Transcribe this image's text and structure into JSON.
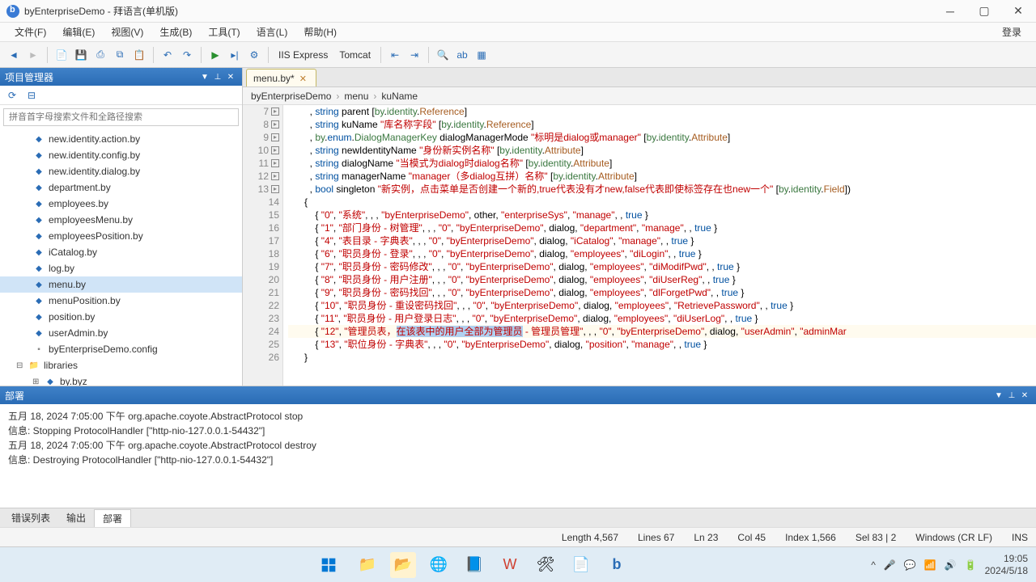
{
  "window": {
    "title": "byEnterpriseDemo - 拜语言(单机版)"
  },
  "menubar": {
    "items": [
      "文件(F)",
      "编辑(E)",
      "视图(V)",
      "生成(B)",
      "工具(T)",
      "语言(L)",
      "帮助(H)"
    ],
    "login": "登录"
  },
  "toolbar": {
    "servers": [
      "IIS Express",
      "Tomcat"
    ]
  },
  "sidebar": {
    "title": "项目管理器",
    "search_placeholder": "拼音首字母搜索文件和全路径搜索",
    "files": [
      "new.identity.action.by",
      "new.identity.config.by",
      "new.identity.dialog.by",
      "department.by",
      "employees.by",
      "employeesMenu.by",
      "employeesPosition.by",
      "iCatalog.by",
      "log.by",
      "menu.by",
      "menuPosition.by",
      "position.by",
      "userAdmin.by"
    ],
    "config": "byEnterpriseDemo.config",
    "libraries": "libraries",
    "libitem": "by.byz"
  },
  "editor": {
    "tab": "menu.by*",
    "breadcrumb": [
      "byEnterpriseDemo",
      "menu",
      "kuName"
    ],
    "lines": [
      {
        "n": 7,
        "html": "        , <span class='c-kw'>string</span> parent [<span class='c-id'>by</span>.<span class='c-id'>identity</span>.<span class='c-attr'>Reference</span>]"
      },
      {
        "n": 8,
        "html": "        , <span class='c-kw'>string</span> kuName <span class='c-str'>\"库名称字段\"</span> [<span class='c-id'>by</span>.<span class='c-id'>identity</span>.<span class='c-attr'>Reference</span>]"
      },
      {
        "n": 9,
        "html": "        , <span class='c-id'>by</span>.<span class='c-kw'>enum</span>.<span class='c-id'>DialogManagerKey</span> dialogManagerMode <span class='c-str'>\"标明是dialog或manager\"</span> [<span class='c-id'>by</span>.<span class='c-id'>identity</span>.<span class='c-attr'>Attribute</span>]"
      },
      {
        "n": 10,
        "html": "        , <span class='c-kw'>string</span> newIdentityName <span class='c-str'>\"身份新实例名称\"</span> [<span class='c-id'>by</span>.<span class='c-id'>identity</span>.<span class='c-attr'>Attribute</span>]"
      },
      {
        "n": 11,
        "html": "        , <span class='c-kw'>string</span> dialogName <span class='c-str'>\"当模式为dialog时dialog名称\"</span> [<span class='c-id'>by</span>.<span class='c-id'>identity</span>.<span class='c-attr'>Attribute</span>]"
      },
      {
        "n": 12,
        "html": "        , <span class='c-kw'>string</span> managerName <span class='c-str'>\"manager（多dialog互拼）名称\"</span> [<span class='c-id'>by</span>.<span class='c-id'>identity</span>.<span class='c-attr'>Attribute</span>]"
      },
      {
        "n": 13,
        "html": "        , <span class='c-kw'>bool</span> singleton <span class='c-str'>\"新实例，点击菜单是否创建一个新的,true代表没有才new,false代表即使标签存在也new一个\"</span> [<span class='c-id'>by</span>.<span class='c-id'>identity</span>.<span class='c-attr'>Field</span>])"
      },
      {
        "n": 14,
        "html": "      {"
      },
      {
        "n": 15,
        "html": "          { <span class='c-str'>\"0\"</span>, <span class='c-str'>\"系统\"</span>, , , <span class='c-str'>\"byEnterpriseDemo\"</span>, other, <span class='c-str'>\"enterpriseSys\"</span>, <span class='c-str'>\"manage\"</span>, , <span class='c-bool'>true</span> }"
      },
      {
        "n": 16,
        "html": "          { <span class='c-str'>\"1\"</span>, <span class='c-str'>\"部门身份 - 树管理\"</span>, , , <span class='c-str'>\"0\"</span>, <span class='c-str'>\"byEnterpriseDemo\"</span>, dialog, <span class='c-str'>\"department\"</span>, <span class='c-str'>\"manage\"</span>, , <span class='c-bool'>true</span> }"
      },
      {
        "n": 17,
        "html": "          { <span class='c-str'>\"4\"</span>, <span class='c-str'>\"表目录 - 字典表\"</span>, , , <span class='c-str'>\"0\"</span>, <span class='c-str'>\"byEnterpriseDemo\"</span>, dialog, <span class='c-str'>\"iCatalog\"</span>, <span class='c-str'>\"manage\"</span>, , <span class='c-bool'>true</span> }"
      },
      {
        "n": 18,
        "html": "          { <span class='c-str'>\"6\"</span>, <span class='c-str'>\"职员身份 - 登录\"</span>, , , <span class='c-str'>\"0\"</span>, <span class='c-str'>\"byEnterpriseDemo\"</span>, dialog, <span class='c-str'>\"employees\"</span>, <span class='c-str'>\"diLogin\"</span>, , <span class='c-bool'>true</span> }"
      },
      {
        "n": 19,
        "html": "          { <span class='c-str'>\"7\"</span>, <span class='c-str'>\"职员身份 - 密码修改\"</span>, , , <span class='c-str'>\"0\"</span>, <span class='c-str'>\"byEnterpriseDemo\"</span>, dialog, <span class='c-str'>\"employees\"</span>, <span class='c-str'>\"diModifPwd\"</span>, , <span class='c-bool'>true</span> }"
      },
      {
        "n": 20,
        "html": "          { <span class='c-str'>\"8\"</span>, <span class='c-str'>\"职员身份 - 用户注册\"</span>, , , <span class='c-str'>\"0\"</span>, <span class='c-str'>\"byEnterpriseDemo\"</span>, dialog, <span class='c-str'>\"employees\"</span>, <span class='c-str'>\"diUserReg\"</span>, , <span class='c-bool'>true</span> }"
      },
      {
        "n": 21,
        "html": "          { <span class='c-str'>\"9\"</span>, <span class='c-str'>\"职员身份 - 密码找回\"</span>, , , <span class='c-str'>\"0\"</span>, <span class='c-str'>\"byEnterpriseDemo\"</span>, dialog, <span class='c-str'>\"employees\"</span>, <span class='c-str'>\"dlForgetPwd\"</span>, , <span class='c-bool'>true</span> }"
      },
      {
        "n": 22,
        "html": "          { <span class='c-str'>\"10\"</span>, <span class='c-str'>\"职员身份 - 重设密码找回\"</span>, , , <span class='c-str'>\"0\"</span>, <span class='c-str'>\"byEnterpriseDemo\"</span>, dialog, <span class='c-str'>\"employees\"</span>, <span class='c-str'>\"RetrievePassword\"</span>, , <span class='c-bool'>true</span> }"
      },
      {
        "n": 23,
        "html": "          { <span class='c-str'>\"11\"</span>, <span class='c-str'>\"职员身份 - 用户登录日志\"</span>, , , <span class='c-str'>\"0\"</span>, <span class='c-str'>\"byEnterpriseDemo\"</span>, dialog, <span class='c-str'>\"employees\"</span>, <span class='c-str'>\"diUserLog\"</span>, , <span class='c-bool'>true</span> }"
      },
      {
        "n": 24,
        "hl": true,
        "html": "          { <span class='c-str'>\"12\"</span>, <span class='c-str'>\"管理员表，<span class='c-sel'>在该表中的用户全部为管理员</span> - 管理员管理\"</span>, , , <span class='c-str'>\"0\"</span>, <span class='c-str'>\"byEnterpriseDemo\"</span>, dialog, <span class='c-str'>\"userAdmin\"</span>, <span class='c-str'>\"adminMar</span>"
      },
      {
        "n": 25,
        "html": "          { <span class='c-str'>\"13\"</span>, <span class='c-str'>\"职位身份 - 字典表\"</span>, , , <span class='c-str'>\"0\"</span>, <span class='c-str'>\"byEnterpriseDemo\"</span>, dialog, <span class='c-str'>\"position\"</span>, <span class='c-str'>\"manage\"</span>, , <span class='c-bool'>true</span> }"
      },
      {
        "n": 26,
        "html": "      }"
      }
    ]
  },
  "output": {
    "title": "部署",
    "lines": [
      "五月 18, 2024 7:05:00 下午 org.apache.coyote.AbstractProtocol stop",
      "信息: Stopping ProtocolHandler [\"http-nio-127.0.0.1-54432\"]",
      "五月 18, 2024 7:05:00 下午 org.apache.coyote.AbstractProtocol destroy",
      "信息: Destroying ProtocolHandler [\"http-nio-127.0.0.1-54432\"]"
    ],
    "tabs": [
      "错误列表",
      "输出",
      "部署"
    ]
  },
  "statusbar": {
    "length": "Length 4,567",
    "lines": "Lines 67",
    "ln": "Ln 23",
    "col": "Col 45",
    "index": "Index 1,566",
    "sel": "Sel 83 | 2",
    "eol": "Windows (CR LF)",
    "mode": "INS"
  },
  "taskbar": {
    "time": "19:05",
    "date": "2024/5/18"
  }
}
